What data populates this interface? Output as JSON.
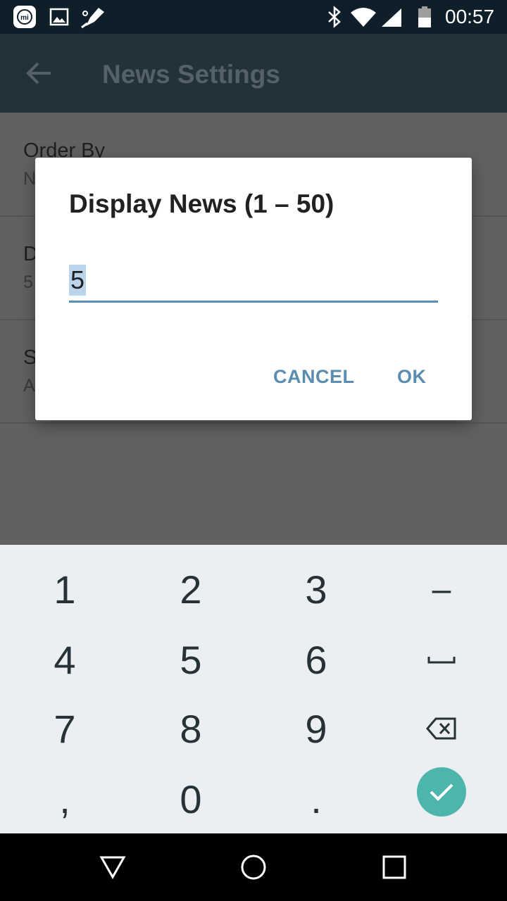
{
  "status_bar": {
    "time": "00:57",
    "icons": [
      "mi-icon",
      "image-icon",
      "pen-icon",
      "bluetooth-icon",
      "wifi-icon",
      "signal-icon",
      "battery-icon"
    ]
  },
  "app_bar": {
    "title": "News Settings",
    "back_icon": "arrow-back-icon"
  },
  "settings": {
    "items": [
      {
        "title": "Order By",
        "subtitle": "N"
      },
      {
        "title": "D",
        "subtitle": "5"
      },
      {
        "title": "S",
        "subtitle": "A"
      }
    ]
  },
  "dialog": {
    "title": "Display News (1 – 50)",
    "input_value": "5",
    "cancel_label": "CANCEL",
    "ok_label": "OK"
  },
  "keyboard": {
    "rows": [
      [
        "1",
        "2",
        "3",
        "–"
      ],
      [
        "4",
        "5",
        "6",
        "space"
      ],
      [
        "7",
        "8",
        "9",
        "backspace"
      ],
      [
        ",",
        "0",
        ".",
        "enter"
      ]
    ]
  },
  "colors": {
    "accent": "#5a8db0",
    "app_bar": "#233138",
    "status_bar": "#0f1f2a",
    "enter_button": "#4db6ac",
    "keyboard_bg": "#eceff1"
  }
}
